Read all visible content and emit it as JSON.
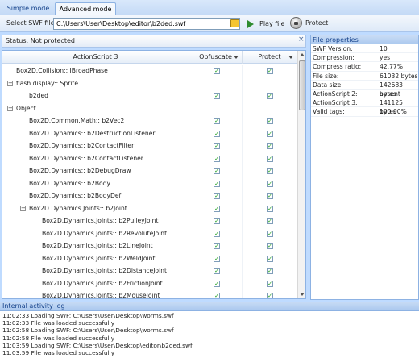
{
  "tabs": [
    {
      "label": "Simple mode",
      "active": false
    },
    {
      "label": "Advanced mode",
      "active": true
    }
  ],
  "toolbar": {
    "select_label": "Select SWF file:",
    "file_path": "C:\\Users\\User\\Desktop\\editor\\b2ded.swf",
    "play_label": "Play file",
    "protect_label": "Protect"
  },
  "status": {
    "text": "Status: Not protected",
    "close_glyph": "×"
  },
  "table": {
    "headers": {
      "name": "ActionScript 3",
      "obfuscate": "Obfuscate",
      "protect": "Protect"
    },
    "rows": [
      {
        "name": "Box2D.Collision:: IBroadPhase",
        "indent": 1,
        "expander": "",
        "obfuscate": true,
        "protect": true
      },
      {
        "name": "flash.display:: Sprite",
        "indent": 0,
        "expander": "−",
        "obfuscate": null,
        "protect": null
      },
      {
        "name": "b2ded",
        "indent": 2,
        "expander": "",
        "obfuscate": true,
        "protect": true
      },
      {
        "name": "Object",
        "indent": 0,
        "expander": "−",
        "obfuscate": null,
        "protect": null
      },
      {
        "name": "Box2D.Common.Math:: b2Vec2",
        "indent": 2,
        "expander": "",
        "obfuscate": true,
        "protect": true
      },
      {
        "name": "Box2D.Dynamics:: b2DestructionListener",
        "indent": 2,
        "expander": "",
        "obfuscate": true,
        "protect": true
      },
      {
        "name": "Box2D.Dynamics:: b2ContactFilter",
        "indent": 2,
        "expander": "",
        "obfuscate": true,
        "protect": true
      },
      {
        "name": "Box2D.Dynamics:: b2ContactListener",
        "indent": 2,
        "expander": "",
        "obfuscate": true,
        "protect": true
      },
      {
        "name": "Box2D.Dynamics:: b2DebugDraw",
        "indent": 2,
        "expander": "",
        "obfuscate": true,
        "protect": true
      },
      {
        "name": "Box2D.Dynamics:: b2Body",
        "indent": 2,
        "expander": "",
        "obfuscate": true,
        "protect": true
      },
      {
        "name": "Box2D.Dynamics:: b2BodyDef",
        "indent": 2,
        "expander": "",
        "obfuscate": true,
        "protect": true
      },
      {
        "name": "Box2D.Dynamics.Joints:: b2Joint",
        "indent": 1,
        "expander": "−",
        "obfuscate": true,
        "protect": true
      },
      {
        "name": "Box2D.Dynamics.Joints:: b2PulleyJoint",
        "indent": 3,
        "expander": "",
        "obfuscate": true,
        "protect": true
      },
      {
        "name": "Box2D.Dynamics.Joints:: b2RevoluteJoint",
        "indent": 3,
        "expander": "",
        "obfuscate": true,
        "protect": true
      },
      {
        "name": "Box2D.Dynamics.Joints:: b2LineJoint",
        "indent": 3,
        "expander": "",
        "obfuscate": true,
        "protect": true
      },
      {
        "name": "Box2D.Dynamics.Joints:: b2WeldJoint",
        "indent": 3,
        "expander": "",
        "obfuscate": true,
        "protect": true
      },
      {
        "name": "Box2D.Dynamics.Joints:: b2DistanceJoint",
        "indent": 3,
        "expander": "",
        "obfuscate": true,
        "protect": true
      },
      {
        "name": "Box2D.Dynamics.Joints:: b2FrictionJoint",
        "indent": 3,
        "expander": "",
        "obfuscate": true,
        "protect": true
      },
      {
        "name": "Box2D.Dynamics.Joints:: b2MouseJoint",
        "indent": 3,
        "expander": "",
        "obfuscate": true,
        "protect": true
      }
    ]
  },
  "properties": {
    "title": "File properties",
    "items": [
      {
        "key": "SWF Version:",
        "value": "10"
      },
      {
        "key": "Compression:",
        "value": "yes"
      },
      {
        "key": "Compress ratio:",
        "value": "42.77%"
      },
      {
        "key": "File size:",
        "value": "61032 bytes"
      },
      {
        "key": "Data size:",
        "value": "142683 bytes"
      },
      {
        "key": "ActionScript 2:",
        "value": "absent"
      },
      {
        "key": "ActionScript 3:",
        "value": "141125 bytes"
      },
      {
        "key": "Valid tags:",
        "value": "100.00%"
      }
    ]
  },
  "log": {
    "title": "Internal activity log",
    "lines": [
      "11:02:33 Loading SWF: C:\\Users\\User\\Desktop\\worms.swf",
      "11:02:33 File was loaded successfully",
      "11:02:58 Loading SWF: C:\\Users\\User\\Desktop\\worms.swf",
      "11:02:58 File was loaded successfully",
      "11:03:59 Loading SWF: C:\\Users\\User\\Desktop\\editor\\b2ded.swf",
      "11:03:59 File was loaded successfully"
    ]
  },
  "icons": {
    "browse": "folder-icon",
    "play": "play-icon",
    "protect": "shield-lock-icon",
    "check": "✓"
  },
  "colors": {
    "chrome": "#bfdbff",
    "panel_header": "#aac8ee",
    "check": "#21a121",
    "play": "#2f8c2f"
  }
}
